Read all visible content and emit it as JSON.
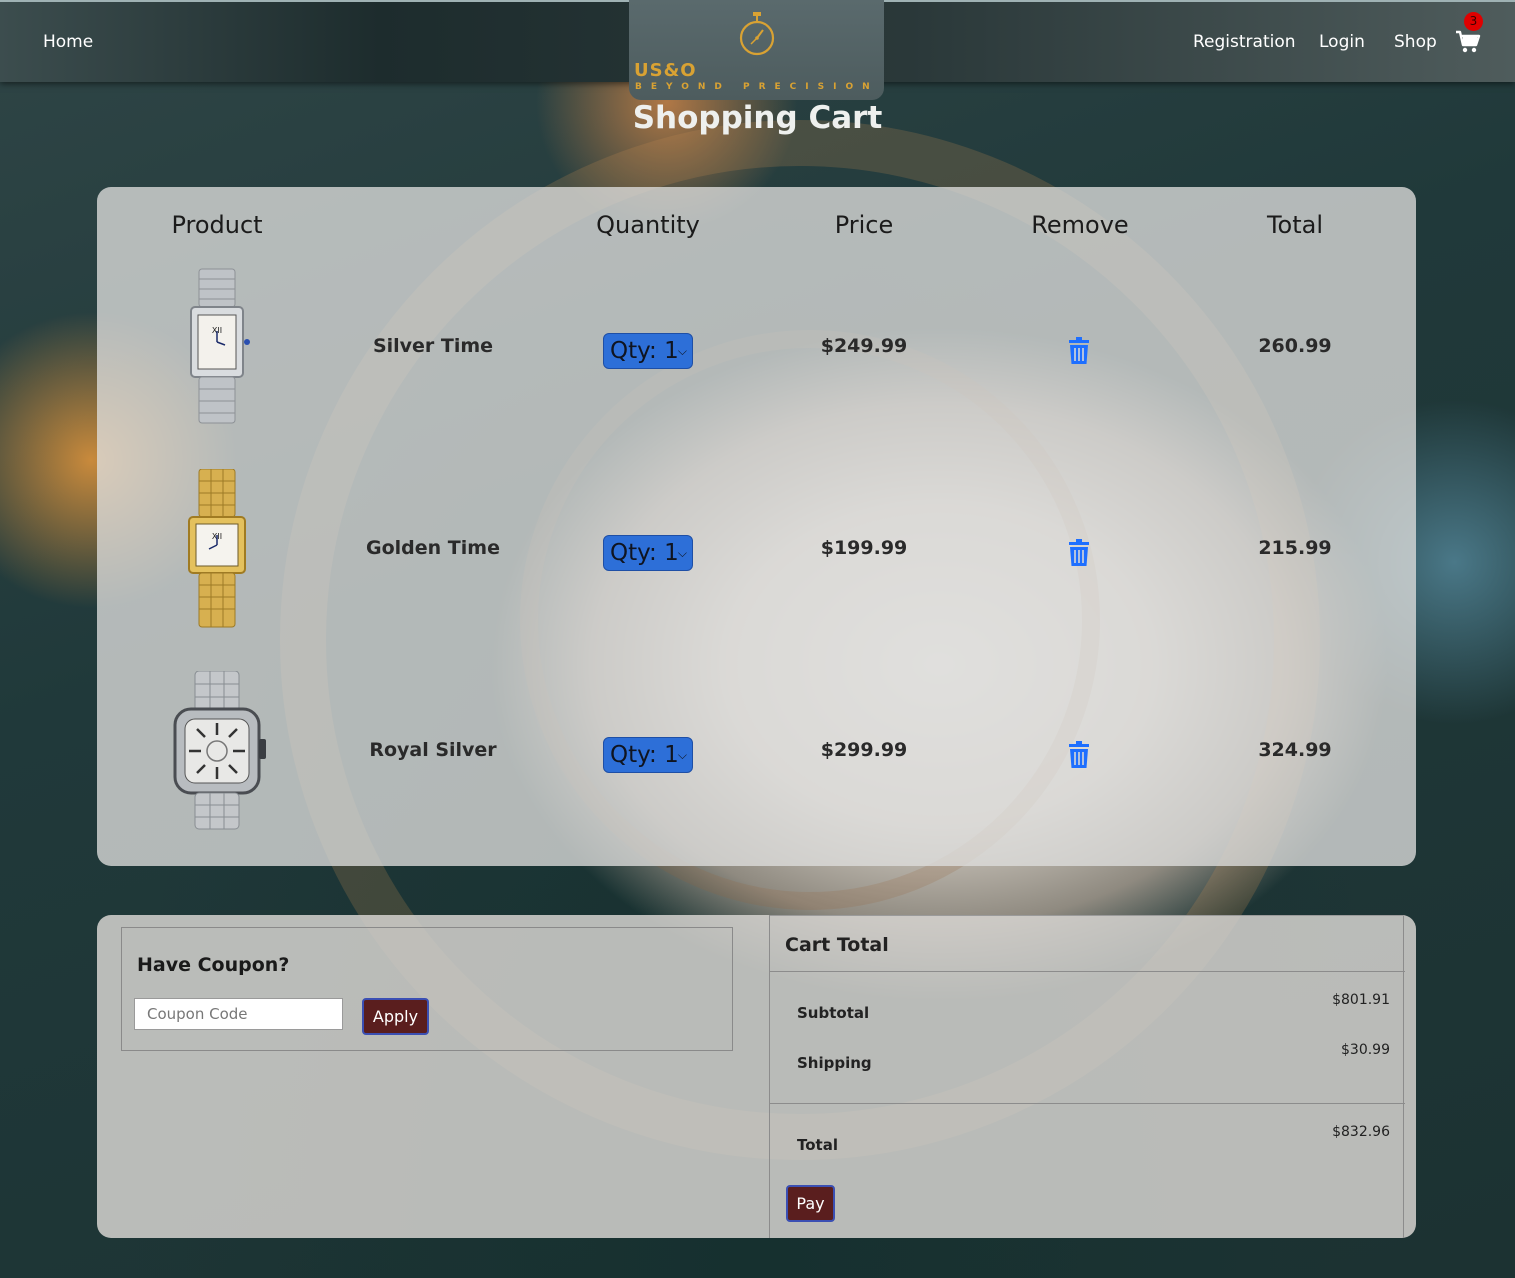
{
  "nav": {
    "home": "Home",
    "registration": "Registration",
    "login": "Login",
    "shop": "Shop",
    "cart_count": "3"
  },
  "logo": {
    "brand": "US&O",
    "tagline": "BEYOND PRECISION",
    "color": "#d9a233"
  },
  "page_title": "Shopping Cart",
  "table": {
    "headers": {
      "product": "Product",
      "quantity": "Quantity",
      "price": "Price",
      "remove": "Remove",
      "total": "Total"
    },
    "rows": [
      {
        "name": "Silver Time",
        "qty": "Qty: 1",
        "price": "$249.99",
        "total": "260.99",
        "watch": "silver-tank"
      },
      {
        "name": "Golden Time",
        "qty": "Qty: 1",
        "price": "$199.99",
        "total": "215.99",
        "watch": "gold-panthere"
      },
      {
        "name": "Royal Silver",
        "qty": "Qty: 1",
        "price": "$299.99",
        "total": "324.99",
        "watch": "santos-skeleton"
      }
    ]
  },
  "coupon": {
    "title": "Have Coupon?",
    "placeholder": "Coupon Code",
    "apply": "Apply"
  },
  "cart_total": {
    "title": "Cart Total",
    "subtotal_label": "Subtotal",
    "subtotal_value": "$801.91",
    "shipping_label": "Shipping",
    "shipping_value": "$30.99",
    "total_label": "Total",
    "total_value": "$832.96",
    "pay": "Pay"
  },
  "colors": {
    "qty_select": "#2d6fd8",
    "trash_icon": "#1e6fff",
    "button_bg": "#5a1e1e",
    "badge": "#e00000"
  }
}
